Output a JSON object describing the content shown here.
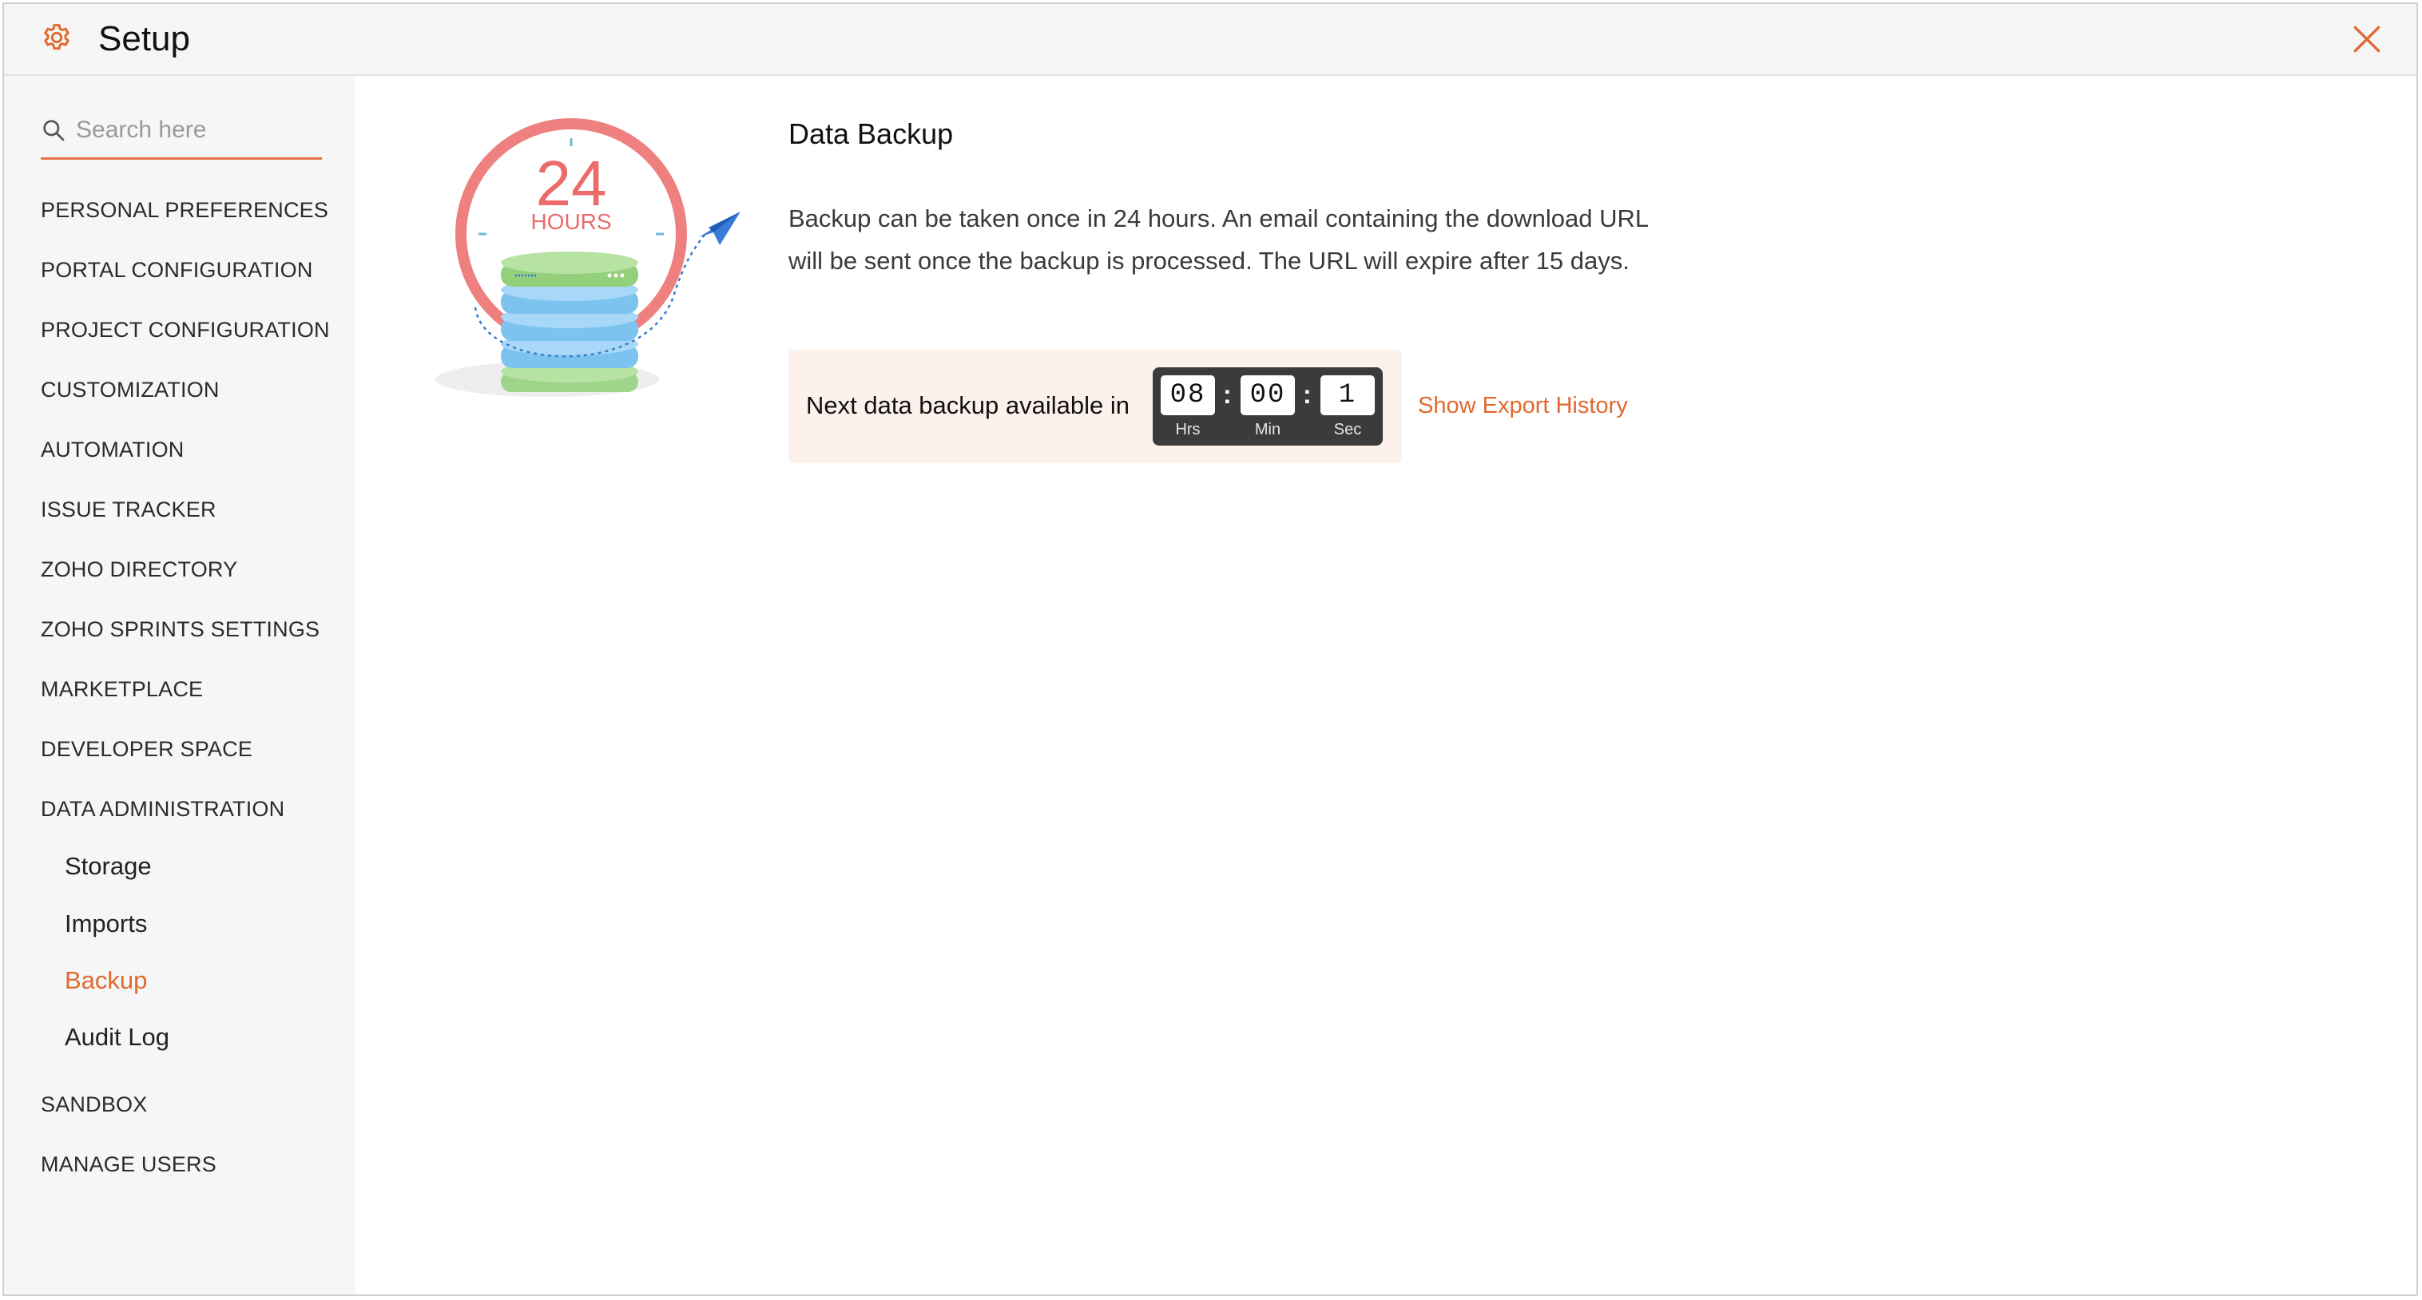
{
  "window": {
    "title": "Setup",
    "icons": {
      "app": "gear-icon",
      "close": "close-icon"
    },
    "accent_color": "#e0692e"
  },
  "sidebar": {
    "search": {
      "placeholder": "Search here",
      "value": "",
      "icon": "search-icon"
    },
    "items": [
      {
        "label": "PERSONAL PREFERENCES"
      },
      {
        "label": "PORTAL CONFIGURATION"
      },
      {
        "label": "PROJECT CONFIGURATION"
      },
      {
        "label": "CUSTOMIZATION"
      },
      {
        "label": "AUTOMATION"
      },
      {
        "label": "ISSUE TRACKER"
      },
      {
        "label": "ZOHO DIRECTORY"
      },
      {
        "label": "ZOHO SPRINTS SETTINGS"
      },
      {
        "label": "MARKETPLACE"
      },
      {
        "label": "DEVELOPER SPACE"
      },
      {
        "label": "DATA ADMINISTRATION"
      },
      {
        "label": "SANDBOX"
      },
      {
        "label": "MANAGE USERS"
      }
    ],
    "data_admin_subitems": [
      {
        "label": "Storage",
        "active": false
      },
      {
        "label": "Imports",
        "active": false
      },
      {
        "label": "Backup",
        "active": true
      },
      {
        "label": "Audit Log",
        "active": false
      }
    ]
  },
  "main": {
    "illustration": {
      "number": "24",
      "unit": "HOURS"
    },
    "title": "Data Backup",
    "description": "Backup can be taken once in 24 hours. An email containing the download URL will be sent once the backup is processed. The URL will expire after 15 days.",
    "next_backup_label": "Next data backup available in",
    "timer": {
      "hours": "08",
      "hours_unit": "Hrs",
      "minutes": "00",
      "minutes_unit": "Min",
      "seconds": "1",
      "seconds_unit": "Sec",
      "separator": ":"
    },
    "export_history_link": "Show Export History"
  }
}
